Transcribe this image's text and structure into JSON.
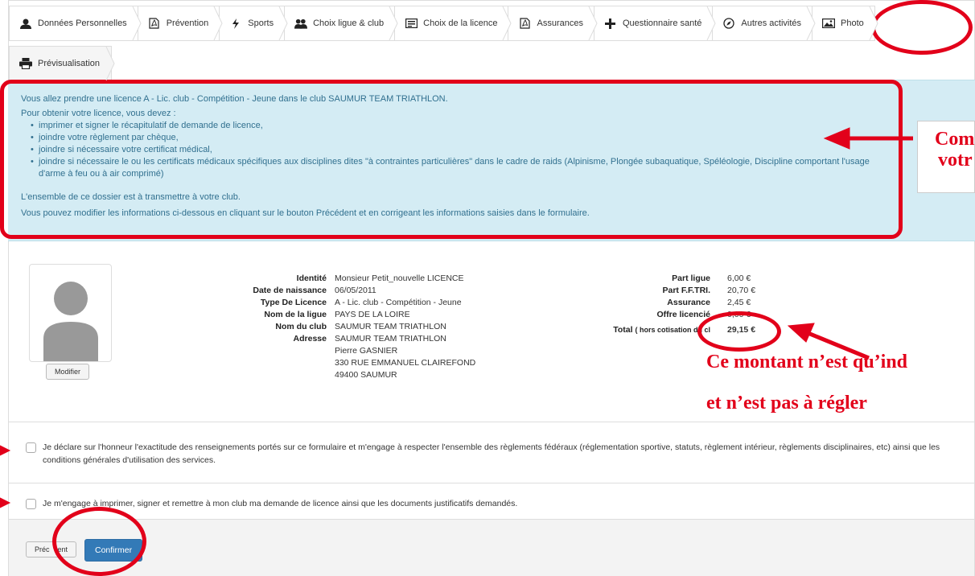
{
  "tabs_row1": [
    {
      "label": "Données Personnelles",
      "icon": "user-icon"
    },
    {
      "label": "Prévention",
      "icon": "pdf-icon"
    },
    {
      "label": "Sports",
      "icon": "bolt-icon"
    },
    {
      "label": "Choix ligue & club",
      "icon": "users-icon"
    },
    {
      "label": "Choix de la licence",
      "icon": "card-icon"
    },
    {
      "label": "Assurances",
      "icon": "pdf-icon"
    },
    {
      "label": "Questionnaire santé",
      "icon": "plus-icon"
    },
    {
      "label": "Autres activités",
      "icon": "compass-icon"
    },
    {
      "label": "Photo",
      "icon": "image-icon"
    }
  ],
  "tabs_row2": [
    {
      "label": "Prévisualisation",
      "icon": "print-icon"
    }
  ],
  "info": {
    "line1": "Vous allez prendre une licence A - Lic. club - Compétition - Jeune dans le club SAUMUR TEAM TRIATHLON.",
    "line2": "Pour obtenir votre licence, vous devez :",
    "bullets": [
      "imprimer et signer le récapitulatif de demande de licence,",
      "joindre votre règlement par chèque,",
      "joindre si nécessaire votre certificat médical,",
      "joindre si nécessaire le ou les certificats médicaux spécifiques aux disciplines dites \"à contraintes particulières\" dans le cadre de raids (Alpinisme, Plongée subaquatique, Spéléologie, Discipline comportant l'usage d'arme à feu ou à air comprimé)"
    ],
    "line3": "L'ensemble de ce dossier est à transmettre à votre club.",
    "line4": "Vous pouvez modifier les informations ci-dessous en cliquant sur le bouton Précédent et en corrigeant les informations saisies dans le formulaire."
  },
  "annotations": {
    "callout_top_1": "Com",
    "callout_top_2": "votr",
    "callout_mid_1": "Ce montant n’est qu’ind",
    "callout_mid_2": "et n’est pas à régler"
  },
  "profile": {
    "modifier_label": "Modifier",
    "identity": [
      {
        "label": "Identité",
        "value": "Monsieur Petit_nouvelle LICENCE"
      },
      {
        "label": "Date de naissance",
        "value": "06/05/2011"
      },
      {
        "label": "Type De Licence",
        "value": "A - Lic. club - Compétition - Jeune"
      },
      {
        "label": "Nom de la ligue",
        "value": "PAYS DE LA LOIRE"
      },
      {
        "label": "Nom du club",
        "value": "SAUMUR TEAM TRIATHLON"
      },
      {
        "label": "Adresse",
        "value": "SAUMUR TEAM TRIATHLON"
      }
    ],
    "address_lines": [
      "Pierre GASNIER",
      "330 RUE EMMANUEL CLAIREFOND",
      "49400 SAUMUR"
    ],
    "costs": [
      {
        "label": "Part ligue",
        "value": "6,00 €"
      },
      {
        "label": "Part F.F.TRI.",
        "value": "20,70 €"
      },
      {
        "label": "Assurance",
        "value": "2,45 €"
      },
      {
        "label": "Offre licencié",
        "value": "0,00 €"
      }
    ],
    "total_label": "Total",
    "total_sub": "( hors cotisation du cl",
    "total_value": "29,15 €"
  },
  "checks": {
    "honour": "Je déclare sur l'honneur l'exactitude des renseignements portés sur ce formulaire et m'engage à respecter l'ensemble des règlements fédéraux (réglementation sportive, statuts, règlement intérieur, règlements disciplinaires, etc) ainsi que les conditions générales d'utilisation des services.",
    "commit": "Je m'engage à imprimer, signer et remettre à mon club ma demande de licence ainsi que les documents justificatifs demandés."
  },
  "footer": {
    "previous_label": "Préc    ent",
    "confirm_label": "Confirmer"
  },
  "colors": {
    "annotation_red": "#e2001a",
    "info_bg": "#d4ecf4",
    "info_text": "#31708f",
    "primary": "#337ab7"
  }
}
